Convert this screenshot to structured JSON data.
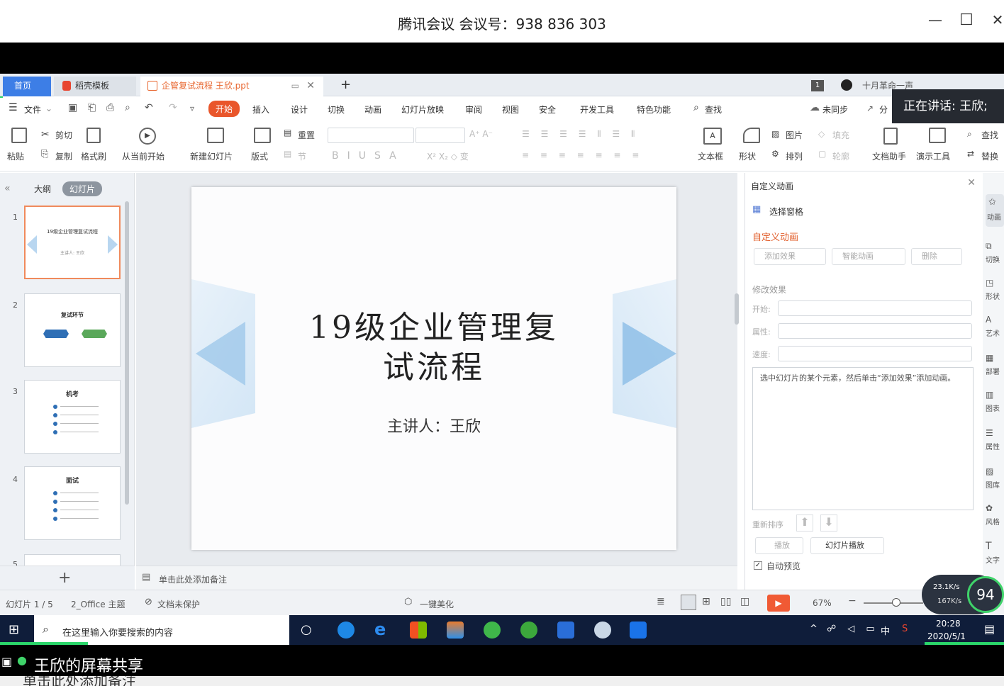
{
  "window": {
    "title": "腾讯会议 会议号：938 836 303",
    "minimize": "—",
    "maximize": "☐",
    "close": "✕"
  },
  "speaking_badge": "正在讲话: 王欣;",
  "tabs": {
    "home": "首页",
    "template": "稻壳模板",
    "doc": "企管复试流程 王欣.ppt",
    "new_tab": "+",
    "user": "十月革命一声"
  },
  "menu": [
    "文件",
    "开始",
    "插入",
    "设计",
    "切换",
    "动画",
    "幻灯片放映",
    "审阅",
    "视图",
    "安全",
    "开发工具",
    "特色功能",
    "查找"
  ],
  "menu_right": [
    "未同步",
    "分"
  ],
  "ribbon": {
    "paste": "粘贴",
    "cut": "剪切",
    "copy": "复制",
    "format_painter": "格式刷",
    "from_current": "从当前开始",
    "new_slide": "新建幻灯片",
    "layout": "版式",
    "reset": "重置",
    "section": "节",
    "textbox": "文本框",
    "shape": "形状",
    "picture": "图片",
    "arrange": "排列",
    "fill": "填充",
    "outline": "轮廓",
    "doc_helper": "文档助手",
    "presenter_tools": "演示工具",
    "find": "查找",
    "replace": "替换"
  },
  "left_panel": {
    "tab_outline": "大纲",
    "tab_slides": "幻灯片",
    "thumbs": [
      {
        "num": "1",
        "title": "19级企业管理复试流程",
        "sub": "主讲人: 王欣"
      },
      {
        "num": "2",
        "title": "复试环节"
      },
      {
        "num": "3",
        "title": "机考"
      },
      {
        "num": "4",
        "title": "面试"
      },
      {
        "num": "5"
      }
    ],
    "add": "+"
  },
  "slide": {
    "title_line1": "19级企业管理复",
    "title_line2": "试流程",
    "presenter": "主讲人：王欣"
  },
  "notes_placeholder": "单击此处添加备注",
  "right_panel": {
    "header": "自定义动画",
    "select_pane": "选择窗格",
    "section_title": "自定义动画",
    "add_effect": "添加效果",
    "smart_anim": "智能动画",
    "delete": "删除",
    "modify": "修改效果",
    "start_label": "开始:",
    "prop_label": "属性:",
    "speed_label": "速度:",
    "hint": "选中幻灯片的某个元素，然后单击“添加效果”添加动画。",
    "reorder": "重新排序",
    "play": "播放",
    "slideshow": "幻灯片播放",
    "autopreview": "自动预览"
  },
  "far_right": [
    "动画",
    "切换",
    "形状",
    "艺术",
    "部署",
    "图表",
    "属性",
    "图库",
    "风格",
    "文字"
  ],
  "status": {
    "slide_no": "幻灯片 1 / 5",
    "theme": "2_Office 主题",
    "protect": "文档未保护",
    "beautify": "一键美化",
    "zoom": "67%",
    "net_up": "23.1K/s",
    "net_down": "167K/s",
    "percent": "94"
  },
  "taskbar": {
    "search_placeholder": "在这里输入你要搜索的内容",
    "time": "20:28",
    "date": "2020/5/1",
    "ime": "中"
  },
  "share_label": "王欣的屏幕共享",
  "cut_text": "单击此处添加备注"
}
